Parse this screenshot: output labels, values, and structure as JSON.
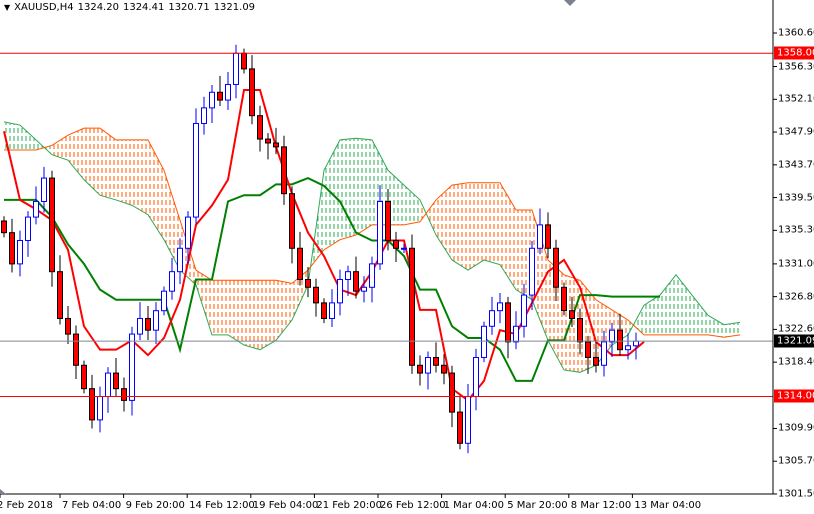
{
  "header": {
    "symbol": "XAUUSD,H4",
    "open": "1324.20",
    "high": "1324.41",
    "low": "1320.71",
    "close": "1321.09"
  },
  "colors": {
    "bull": "#0000ff",
    "bear": "#ff0000",
    "tenkan": "#ff0000",
    "kijun": "#008000",
    "cloud_bull": "#2eaa55",
    "cloud_bear": "#ff5a00",
    "hline": "#ff0000",
    "bidline": "#808890"
  },
  "chart_data": {
    "type": "candlestick",
    "title": "XAUUSD,H4",
    "ylim": [
      1301.5,
      1360.6
    ],
    "y_ticks": [
      "1360.60",
      "1356.30",
      "1352.10",
      "1347.90",
      "1343.70",
      "1339.50",
      "1335.30",
      "1331.00",
      "1326.80",
      "1322.60",
      "1318.40",
      "1309.90",
      "1305.70",
      "1301.50"
    ],
    "x_ticks": [
      "2 Feb 2018",
      "7 Feb 04:00",
      "9 Feb 20:00",
      "14 Feb 12:00",
      "19 Feb 04:00",
      "21 Feb 20:00",
      "26 Feb 12:00",
      "1 Mar 04:00",
      "5 Mar 20:00",
      "8 Mar 12:00",
      "13 Mar 04:00"
    ],
    "closes": [
      1335,
      1331,
      1334,
      1337,
      1339,
      1342,
      1330,
      1324,
      1322,
      1318,
      1315,
      1311,
      1314,
      1317,
      1315,
      1313.5,
      1322,
      1324,
      1322.5,
      1325,
      1327.5,
      1330,
      1333,
      1337,
      1349,
      1351,
      1353,
      1352,
      1354,
      1358,
      1356,
      1350,
      1347,
      1346.5,
      1346,
      1340,
      1333,
      1329,
      1328,
      1326,
      1324,
      1326,
      1329,
      1330,
      1327.5,
      1328,
      1331,
      1339,
      1334,
      1333,
      1333,
      1318,
      1317,
      1319,
      1318,
      1317,
      1312,
      1308,
      1314,
      1319,
      1323,
      1325,
      1326,
      1321,
      1323,
      1327,
      1333,
      1336,
      1333,
      1328,
      1325,
      1324,
      1321,
      1319,
      1318,
      1321,
      1322.5,
      1320,
      1320.5,
      1321.09
    ],
    "tenkan": [
      1348,
      1339.2,
      1338,
      1336.6,
      1332.8,
      1323,
      1320,
      1320,
      1321.2,
      1319.3,
      1321.5,
      1326.4,
      1336,
      1338.5,
      1341.8,
      1353.3,
      1353.3,
      1346,
      1340,
      1335,
      1332,
      1327.7,
      1327,
      1330,
      1334,
      1334,
      1325.1,
      1325.1,
      1315,
      1313.5,
      1316,
      1322.5,
      1322,
      1326,
      1330,
      1331.5,
      1328,
      1321,
      1319.3,
      1319.3,
      1321
    ],
    "kijun": [
      1339.2,
      1339.2,
      1339.2,
      1337,
      1333.5,
      1331,
      1327.7,
      1326.4,
      1326.4,
      1326.4,
      1326.4,
      1320,
      1329,
      1329,
      1339,
      1339.8,
      1339.8,
      1341.2,
      1341.2,
      1342,
      1341,
      1339,
      1335,
      1334,
      1334,
      1332,
      1327.7,
      1327.7,
      1323,
      1321.5,
      1321.5,
      1320,
      1316,
      1316,
      1321.2,
      1321.2,
      1327,
      1327,
      1326.8,
      1326.8,
      1326.8,
      1326.8
    ],
    "senkou_a": [
      1349.2,
      1348.8,
      1346.9,
      1345.0,
      1344.3,
      1341.8,
      1339.8,
      1339.2,
      1338.5,
      1337.3,
      1334.1,
      1330.2,
      1328.3,
      1321.9,
      1321.9,
      1320.6,
      1320.0,
      1321.2,
      1323.8,
      1328.3,
      1343.0,
      1346.9,
      1347.1,
      1346.9,
      1343.0,
      1341.1,
      1339.2,
      1334.7,
      1331.5,
      1330.2,
      1331.5,
      1330.9,
      1327.7,
      1326.4,
      1321.2,
      1317.4,
      1317.1,
      1318.0,
      1320.6,
      1321.9,
      1325.7,
      1327.0,
      1329.6,
      1327.0,
      1324.4,
      1323.2,
      1323.5
    ],
    "senkou_b": [
      1345.6,
      1345.6,
      1345.6,
      1346.2,
      1347.5,
      1348.4,
      1348.4,
      1346.9,
      1346.9,
      1346.9,
      1343.0,
      1336.6,
      1330.2,
      1328.9,
      1328.9,
      1328.9,
      1328.9,
      1328.9,
      1328.5,
      1330.2,
      1332.8,
      1334.1,
      1334.7,
      1336.0,
      1336.0,
      1336.0,
      1336.4,
      1339.2,
      1341.1,
      1341.4,
      1341.4,
      1341.4,
      1337.9,
      1337.9,
      1331.5,
      1329.6,
      1328.9,
      1326.4,
      1325.1,
      1323.8,
      1321.9,
      1321.9,
      1321.9,
      1321.9,
      1321.9,
      1321.6,
      1321.9
    ],
    "hlines": [
      {
        "value": 1358.0,
        "label": "1358.00"
      },
      {
        "value": 1314.0,
        "label": "1314.00"
      }
    ],
    "bid": {
      "value": 1321.09,
      "label": "1321.09"
    }
  }
}
